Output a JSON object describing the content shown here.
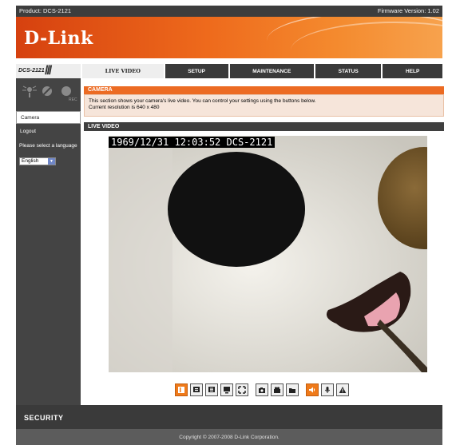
{
  "topbar": {
    "product": "Product: DCS-2121",
    "firmware": "Firmware Version: 1.02"
  },
  "banner": {
    "logo": "D-Link"
  },
  "nav": {
    "model": "DCS-2121",
    "tabs": [
      {
        "label": "LIVE VIDEO",
        "active": true
      },
      {
        "label": "SETUP",
        "active": false
      },
      {
        "label": "MAINTENANCE",
        "active": false
      },
      {
        "label": "STATUS",
        "active": false
      },
      {
        "label": "HELP",
        "active": false
      }
    ]
  },
  "sidebar": {
    "status_icons": [
      "motion-icon",
      "network-icon",
      "record-icon"
    ],
    "rec_label": "REC",
    "items": [
      {
        "label": "Camera"
      },
      {
        "label": "Logout"
      }
    ],
    "language_label": "Please select a language",
    "language_value": "English"
  },
  "main": {
    "camera_title": "CAMERA",
    "description_line1": "This section shows your camera's live video. You can control your settings using the buttons below.",
    "description_line2": "Current resolution is 640 x 480",
    "live_title": "LIVE VIDEO",
    "timestamp": "1969/12/31 12:03:52 DCS-2121"
  },
  "controls": [
    {
      "name": "video-profile-1-button",
      "icon": "profile-1-icon"
    },
    {
      "name": "video-profile-2-button",
      "icon": "profile-2-icon"
    },
    {
      "name": "video-profile-3-button",
      "icon": "profile-3-icon"
    },
    {
      "name": "mobile-view-button",
      "icon": "mobile-icon"
    },
    {
      "name": "full-screen-button",
      "icon": "fullscreen-icon"
    },
    {
      "name": "snapshot-button",
      "icon": "camera-icon"
    },
    {
      "name": "record-button",
      "icon": "record-icon"
    },
    {
      "name": "storage-folder-button",
      "icon": "folder-icon"
    },
    {
      "name": "speaker-button",
      "icon": "speaker-icon"
    },
    {
      "name": "microphone-button",
      "icon": "microphone-icon"
    },
    {
      "name": "digital-output-button",
      "icon": "warning-icon"
    }
  ],
  "footer": {
    "security": "SECURITY",
    "copyright": "Copyright © 2007-2008 D-Link Corporation."
  },
  "colors": {
    "accent": "#ec6b23",
    "dark_bar": "#3a3a3a",
    "sidebar": "#444444"
  }
}
